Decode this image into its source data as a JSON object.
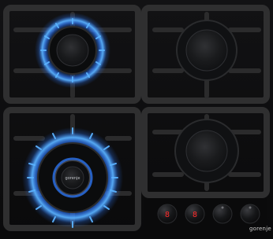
{
  "appliance": {
    "brand": "gorenje",
    "center_badge": "gorenje",
    "colors": {
      "glass": "#0d0d0f",
      "grate": "#1b1b1c",
      "grate_edge": "#2f2f30",
      "flame_blue": "#2f7bff",
      "flame_glow": "#5ab2ff",
      "flame_orange": "#ff8a2a",
      "control_red": "#ff2a2a",
      "knob_dark": "#111214"
    },
    "burners": [
      {
        "id": "front-left",
        "state": "lit",
        "size": "medium"
      },
      {
        "id": "front-right",
        "state": "off",
        "size": "medium"
      },
      {
        "id": "rear-left",
        "state": "lit",
        "size": "wok"
      },
      {
        "id": "rear-right",
        "state": "off",
        "size": "medium"
      }
    ],
    "controls": [
      {
        "id": "control-1",
        "display": "8",
        "style": "red-display"
      },
      {
        "id": "control-2",
        "display": "8",
        "style": "red-display"
      },
      {
        "id": "control-3",
        "display": "",
        "style": "knob"
      },
      {
        "id": "control-4",
        "display": "",
        "style": "knob"
      }
    ]
  }
}
